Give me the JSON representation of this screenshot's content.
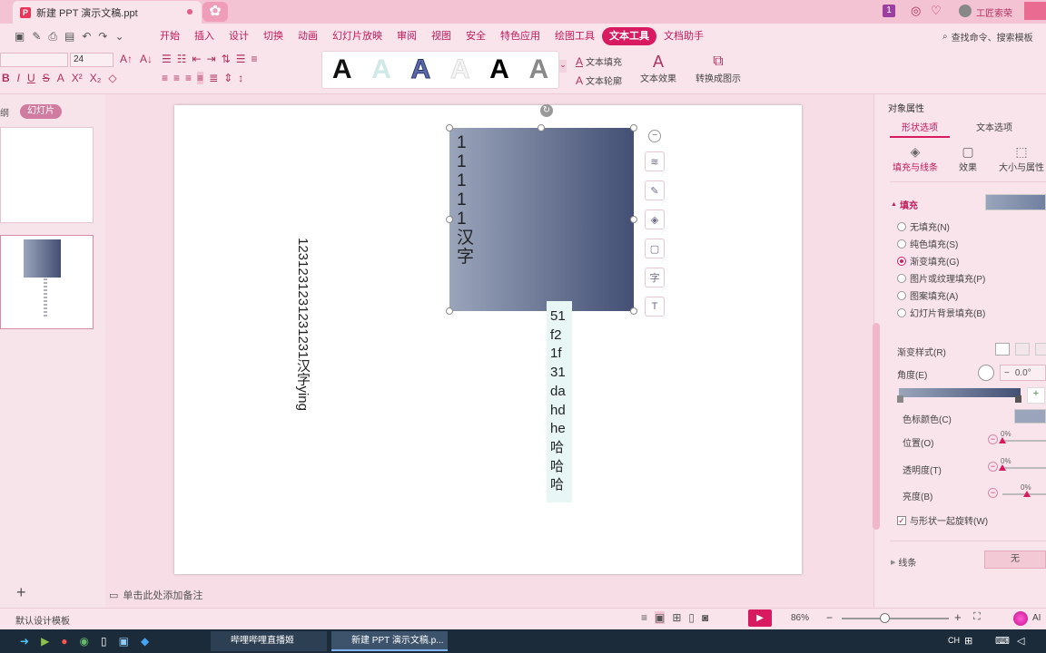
{
  "titlebar": {
    "doc_tab": "新建 PPT 演示文稿.ppt",
    "logo": "P",
    "user_name": "工匠索荣",
    "badge": "1"
  },
  "menu": {
    "tabs": [
      "开始",
      "插入",
      "设计",
      "切换",
      "动画",
      "幻灯片放映",
      "审阅",
      "视图",
      "安全",
      "特色应用",
      "绘图工具",
      "文本工具",
      "文档助手"
    ],
    "active_index": 11,
    "search": "查找命令、搜索模板"
  },
  "ribbon": {
    "font_size": "24",
    "text_fill": "文本填充",
    "text_outline": "文本轮廓",
    "text_effect": "文本效果",
    "convert_graphic": "转换成图示",
    "style_glyph": "A"
  },
  "left_panel": {
    "outline_label": "纲",
    "slides_label": "幻灯片",
    "add_icon": "+"
  },
  "slide": {
    "box_text": [
      "1",
      "1",
      "1",
      "1",
      "1",
      "汉",
      "字"
    ],
    "vertical_text": "1231231231231231汉字ying",
    "column_text": [
      "51",
      "f2",
      "1f",
      "31",
      "da",
      "hd",
      "he",
      "哈",
      "哈",
      "哈"
    ]
  },
  "notes_placeholder": "单击此处添加备注",
  "right_panel": {
    "title": "对象属性",
    "tab_shape": "形状选项",
    "tab_text": "文本选项",
    "sub_fill_line": "填充与线条",
    "sub_effect": "效果",
    "sub_size": "大小与属性",
    "fill_section": "填充",
    "fill_options": [
      "无填充(N)",
      "纯色填充(S)",
      "渐变填充(G)",
      "图片或纹理填充(P)",
      "图案填充(A)",
      "幻灯片背景填充(B)"
    ],
    "selected_fill": 2,
    "gradient_style": "渐变样式(R)",
    "angle_label": "角度(E)",
    "angle_value": "0.0°",
    "stop_color": "色标颜色(C)",
    "position_label": "位置(O)",
    "position_value": "0%",
    "transparency_label": "透明度(T)",
    "transparency_value": "0%",
    "brightness_label": "亮度(B)",
    "brightness_value": "0%",
    "rotate_with_shape": "与形状一起旋转(W)",
    "line_section": "线条",
    "line_value": "无"
  },
  "statusbar": {
    "template": "默认设计模板",
    "zoom": "86%",
    "ai_label": "AI"
  },
  "taskbar": {
    "item1": "哔哩哔哩直播姬",
    "item2": "新建 PPT 演示文稿.p...",
    "lang": "CH"
  },
  "colors": {
    "accent": "#d81b60",
    "gradient_start": "#9aa5bb",
    "gradient_end": "#434f74"
  }
}
